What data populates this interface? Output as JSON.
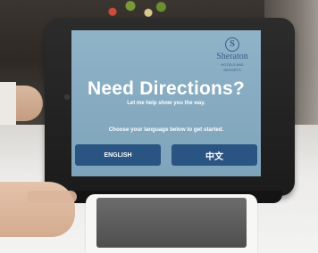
{
  "kiosk": {
    "brand": {
      "mark": "S",
      "name": "Sheraton",
      "tagline_line1": "HOTELS AND",
      "tagline_line2": "RESORTS"
    },
    "title": "Need Directions?",
    "subtitle": "Let me help show you the way.",
    "instruction": "Choose your language below to get started.",
    "buttons": {
      "english_label": "ENGLISH",
      "chinese_label": "中文"
    }
  },
  "colors": {
    "screen_bg": "#8fb3c7",
    "button_bg": "#2a5583",
    "brand": "#3a5f86"
  }
}
